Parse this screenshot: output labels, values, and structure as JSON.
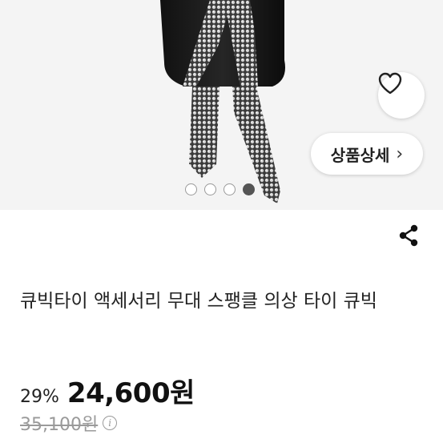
{
  "product": {
    "title": "큐빅타이 액세서리 무대 스팽클 의상 타이 큐빅",
    "discount": "29%",
    "sale_price": "24,600원",
    "original_price": "35,100원"
  },
  "gallery": {
    "detail_button_label": "상품상세",
    "detail_chevron": "›",
    "image_count": 4,
    "active_index": 3
  },
  "icons": {
    "wish": "heart-icon",
    "share": "share-icon",
    "info": "info-icon",
    "detail": "chevron-right-icon"
  },
  "colors": {
    "primary_text": "#111111",
    "muted_text": "#9a9a9a",
    "dot_active": "#555555"
  }
}
